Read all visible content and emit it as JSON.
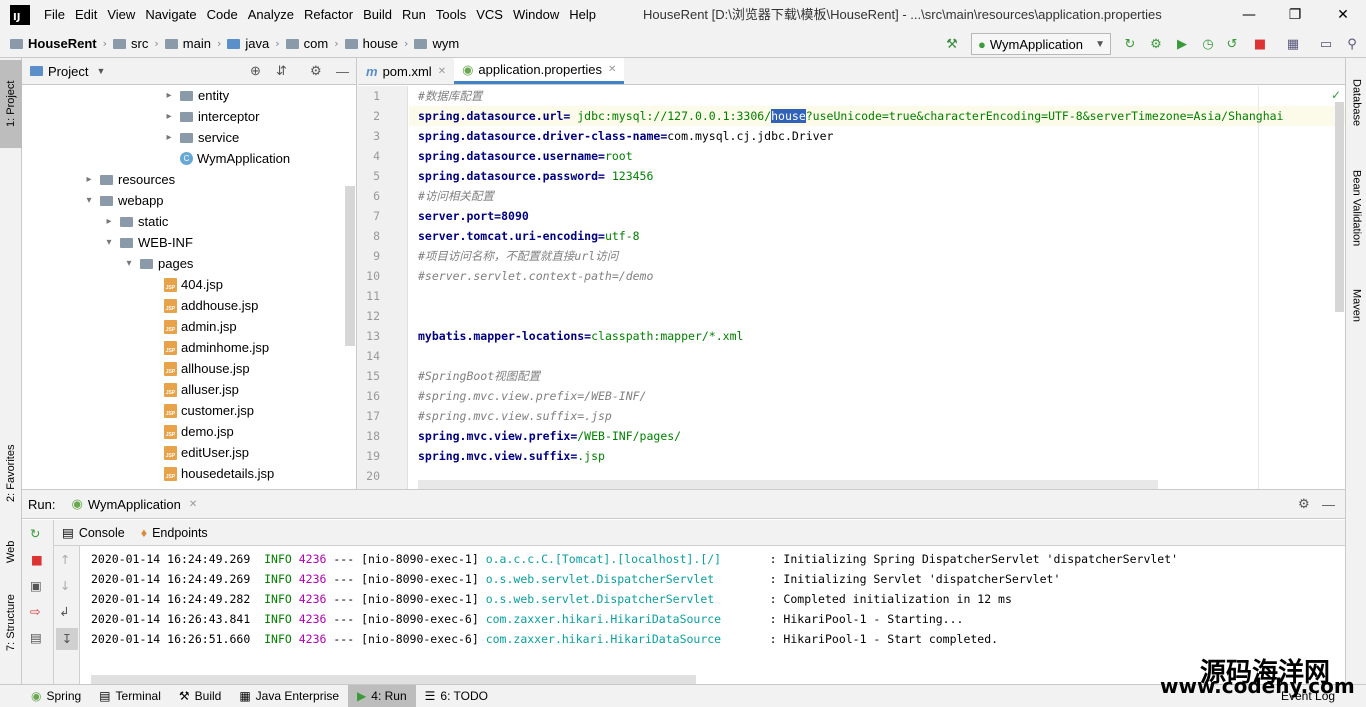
{
  "menubar": {
    "logo": "IJ",
    "items": [
      "File",
      "Edit",
      "View",
      "Navigate",
      "Code",
      "Analyze",
      "Refactor",
      "Build",
      "Run",
      "Tools",
      "VCS",
      "Window",
      "Help"
    ],
    "title": "HouseRent [D:\\浏览器下载\\模板\\HouseRent] - ...\\src\\main\\resources\\application.properties"
  },
  "navbar": {
    "crumbs": [
      "HouseRent",
      "src",
      "main",
      "java",
      "com",
      "house",
      "wym"
    ],
    "run_config": "WymApplication"
  },
  "left_strip": {
    "project": "1: Project",
    "favorites": "2: Favorites",
    "web": "Web",
    "structure": "7: Structure"
  },
  "right_strip": {
    "database": "Database",
    "bean": "Bean Validation",
    "maven": "Maven"
  },
  "project": {
    "header": "Project",
    "tree": [
      {
        "label": "entity",
        "kind": "folder"
      },
      {
        "label": "interceptor",
        "kind": "folder"
      },
      {
        "label": "service",
        "kind": "folder"
      },
      {
        "label": "WymApplication",
        "kind": "class"
      },
      {
        "label": "resources",
        "kind": "folder"
      },
      {
        "label": "webapp",
        "kind": "folder"
      },
      {
        "label": "static",
        "kind": "folder"
      },
      {
        "label": "WEB-INF",
        "kind": "folder"
      },
      {
        "label": "pages",
        "kind": "folder"
      },
      {
        "label": "404.jsp",
        "kind": "jsp"
      },
      {
        "label": "addhouse.jsp",
        "kind": "jsp"
      },
      {
        "label": "admin.jsp",
        "kind": "jsp"
      },
      {
        "label": "adminhome.jsp",
        "kind": "jsp"
      },
      {
        "label": "allhouse.jsp",
        "kind": "jsp"
      },
      {
        "label": "alluser.jsp",
        "kind": "jsp"
      },
      {
        "label": "customer.jsp",
        "kind": "jsp"
      },
      {
        "label": "demo.jsp",
        "kind": "jsp"
      },
      {
        "label": "editUser.jsp",
        "kind": "jsp"
      },
      {
        "label": "housedetails.jsp",
        "kind": "jsp"
      }
    ]
  },
  "editor": {
    "tabs": [
      "pom.xml",
      "application.properties"
    ],
    "lines": {
      "l1": "#数据库配置",
      "l2k": "spring.datasource.url=",
      "l2v1": " jdbc:mysql://127.0.0.1:3306/",
      "l2h": "house",
      "l2v2": "?useUnicode=true&characterEncoding=UTF-8&serverTimezone=Asia/Shanghai",
      "l3k": "spring.datasource.driver-class-name=",
      "l3v": "com.mysql.cj.jdbc.Driver",
      "l4k": "spring.datasource.username=",
      "l4v": "root",
      "l5k": "spring.datasource.password=",
      "l5v": " 123456",
      "l6": "#访问相关配置",
      "l7k": "server.port=",
      "l7v": "8090",
      "l8k": "server.tomcat.uri-encoding=",
      "l8v": "utf-8",
      "l9": "#项目访问名称，不配置就直接url访问",
      "l10": "#server.servlet.context-path=/demo",
      "l13k": "mybatis.mapper-locations=",
      "l13v": "classpath:mapper/*.xml",
      "l15": "#SpringBoot视图配置",
      "l16": "#spring.mvc.view.prefix=/WEB-INF/",
      "l17": "#spring.mvc.view.suffix=.jsp",
      "l18k": "spring.mvc.view.prefix=",
      "l18v": "/WEB-INF/pages/",
      "l19k": "spring.mvc.view.suffix=",
      "l19v": ".jsp"
    }
  },
  "run": {
    "label": "Run:",
    "app": "WymApplication",
    "console_tab": "Console",
    "endpoints_tab": "Endpoints",
    "logs": [
      {
        "ts": "2020-01-14 16:24:49.269",
        "lvl": "INFO",
        "pid": "4236",
        "thread": " --- [nio-8090-exec-1] ",
        "logger": "o.a.c.c.C.[Tomcat].[localhost].[/]      ",
        "msg": " : Initializing Spring DispatcherServlet 'dispatcherServlet'"
      },
      {
        "ts": "2020-01-14 16:24:49.269",
        "lvl": "INFO",
        "pid": "4236",
        "thread": " --- [nio-8090-exec-1] ",
        "logger": "o.s.web.servlet.DispatcherServlet       ",
        "msg": " : Initializing Servlet 'dispatcherServlet'"
      },
      {
        "ts": "2020-01-14 16:24:49.282",
        "lvl": "INFO",
        "pid": "4236",
        "thread": " --- [nio-8090-exec-1] ",
        "logger": "o.s.web.servlet.DispatcherServlet       ",
        "msg": " : Completed initialization in 12 ms"
      },
      {
        "ts": "2020-01-14 16:26:43.841",
        "lvl": "INFO",
        "pid": "4236",
        "thread": " --- [nio-8090-exec-6] ",
        "logger": "com.zaxxer.hikari.HikariDataSource      ",
        "msg": " : HikariPool-1 - Starting..."
      },
      {
        "ts": "2020-01-14 16:26:51.660",
        "lvl": "INFO",
        "pid": "4236",
        "thread": " --- [nio-8090-exec-6] ",
        "logger": "com.zaxxer.hikari.HikariDataSource      ",
        "msg": " : HikariPool-1 - Start completed."
      }
    ]
  },
  "statusbar": {
    "items": [
      "Spring",
      "Terminal",
      "Build",
      "Java Enterprise",
      "4: Run",
      "6: TODO"
    ],
    "event_log": "Event Log"
  },
  "watermark": {
    "cn": "源码海洋网",
    "url": "www.codehy.com"
  }
}
